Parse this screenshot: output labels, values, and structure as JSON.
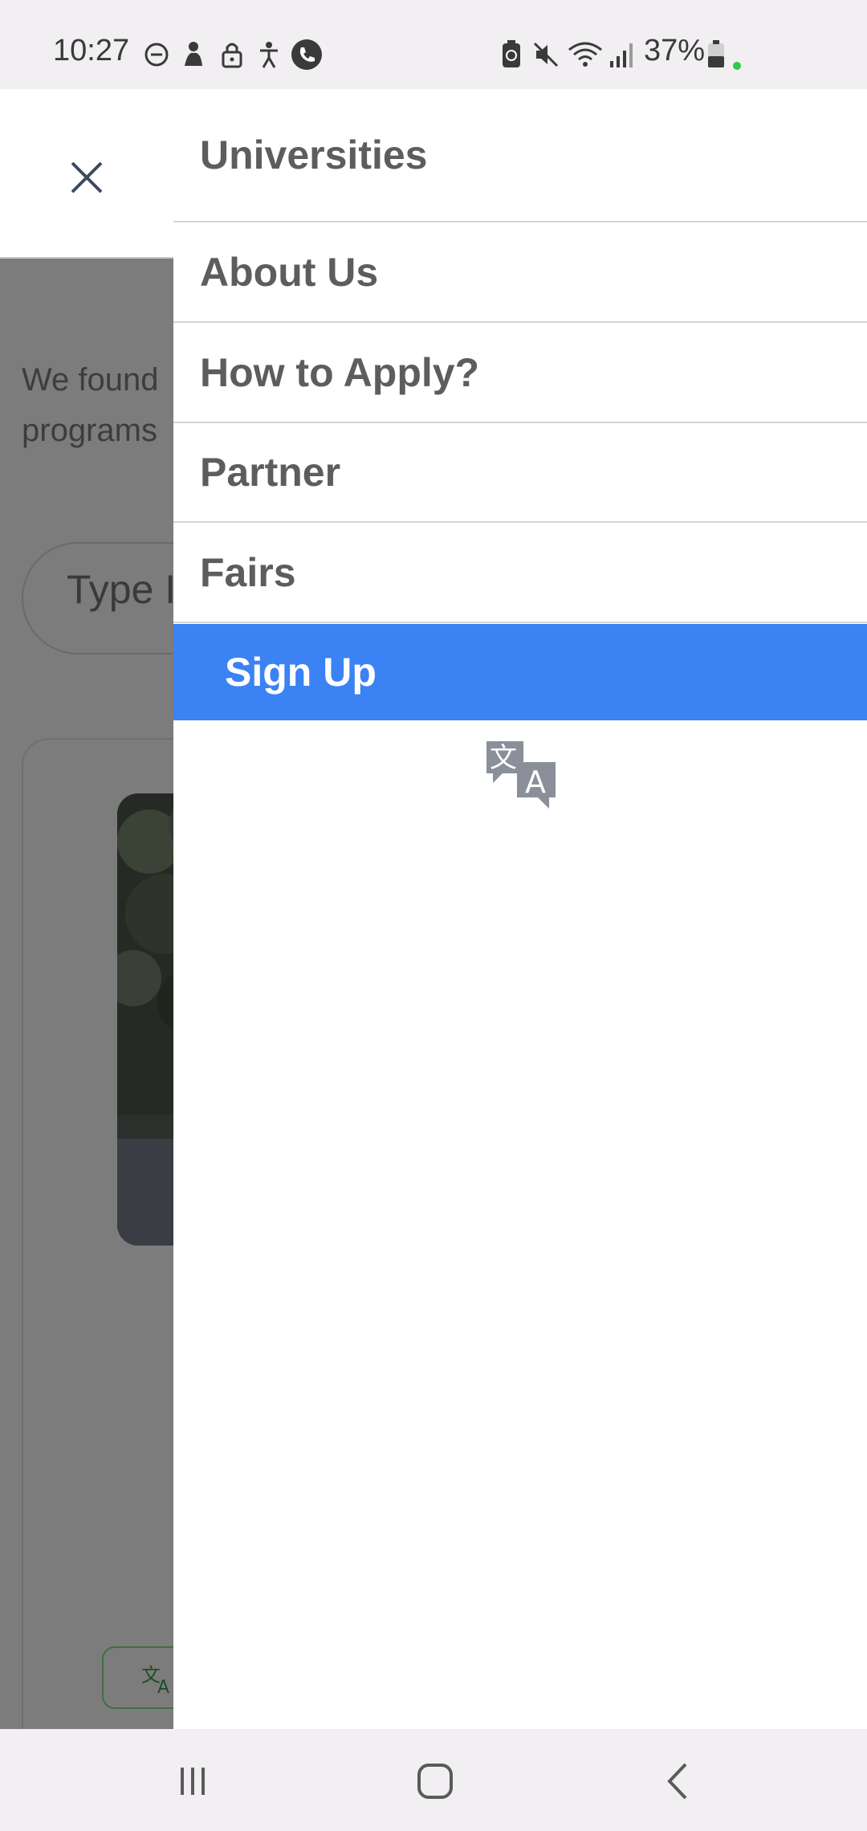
{
  "status_bar": {
    "time": "10:27",
    "battery_percent": "37%",
    "icons_left": [
      "do-not-disturb-icon",
      "notification-icon",
      "lock-icon",
      "accessibility-icon",
      "phone-icon"
    ],
    "icons_right": [
      "battery-saver-icon",
      "mute-icon",
      "wifi-icon",
      "signal-icon",
      "battery-icon"
    ]
  },
  "background_page": {
    "found_text_line1": "We found",
    "found_text_line2": "programs",
    "search_placeholder": "Type In"
  },
  "drawer": {
    "items": [
      {
        "label": "Universities"
      },
      {
        "label": "About Us"
      },
      {
        "label": "How to Apply?"
      },
      {
        "label": "Partner"
      },
      {
        "label": "Fairs"
      }
    ],
    "signup_label": "Sign Up"
  },
  "colors": {
    "accent": "#3b82f4",
    "overlay": "#7c7c7c"
  }
}
